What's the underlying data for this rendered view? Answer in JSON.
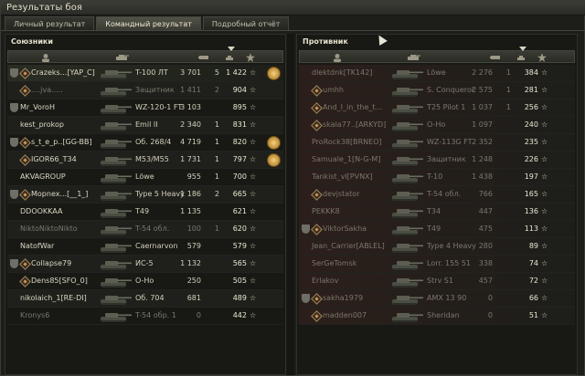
{
  "window": {
    "title": "Результаты боя"
  },
  "tabs": [
    {
      "label": "Личный результат",
      "active": false
    },
    {
      "label": "Командный результат",
      "active": true
    },
    {
      "label": "Подробный отчёт",
      "active": false
    }
  ],
  "allies": {
    "title": "Союзники",
    "rows": [
      {
        "clan_badge": true,
        "platoon": true,
        "name": "Crazeks...[YAP_C]",
        "vehicle": "T-100 ЛТ",
        "damage": "3 701",
        "kills": "5",
        "xp": "1 422",
        "medal": true,
        "dead": false,
        "highlight": true
      },
      {
        "clan_badge": false,
        "platoon": true,
        "name": "....jva.....",
        "vehicle": "Защитник",
        "damage": "1 411",
        "kills": "2",
        "xp": "904",
        "medal": false,
        "dead": true,
        "highlight": false
      },
      {
        "clan_badge": true,
        "platoon": false,
        "name": "Mr_VoroH",
        "vehicle": "WZ-120-1 FT",
        "damage": "3 103",
        "kills": "",
        "xp": "895",
        "medal": false,
        "dead": false,
        "highlight": false
      },
      {
        "clan_badge": false,
        "platoon": false,
        "name": "kest_prokop",
        "vehicle": "Emil II",
        "damage": "2 340",
        "kills": "1",
        "xp": "831",
        "medal": false,
        "dead": false,
        "highlight": false
      },
      {
        "clan_badge": true,
        "platoon": true,
        "name": "s_t_e_p..[GG-BB]",
        "vehicle": "Об. 268/4",
        "damage": "4 719",
        "kills": "1",
        "xp": "820",
        "medal": true,
        "dead": false,
        "highlight": false
      },
      {
        "clan_badge": false,
        "platoon": true,
        "name": "IGOR66_T34",
        "vehicle": "M53/M55",
        "damage": "1 731",
        "kills": "1",
        "xp": "797",
        "medal": true,
        "dead": false,
        "highlight": false
      },
      {
        "clan_badge": false,
        "platoon": false,
        "name": "AKVAGROUP",
        "vehicle": "Löwe",
        "damage": "955",
        "kills": "1",
        "xp": "700",
        "medal": false,
        "dead": false,
        "highlight": false
      },
      {
        "clan_badge": true,
        "platoon": true,
        "name": "Mopnex...[__1_]",
        "vehicle": "Type 5 Heavy",
        "damage": "1 186",
        "kills": "2",
        "xp": "665",
        "medal": false,
        "dead": false,
        "highlight": false
      },
      {
        "clan_badge": false,
        "platoon": false,
        "name": "DDOOKKAA",
        "vehicle": "T49",
        "damage": "1 135",
        "kills": "",
        "xp": "621",
        "medal": false,
        "dead": false,
        "highlight": false
      },
      {
        "clan_badge": false,
        "platoon": false,
        "name": "NiktoNiktoNikto",
        "vehicle": "T-54 обл.",
        "damage": "100",
        "kills": "1",
        "xp": "620",
        "medal": false,
        "dead": true,
        "highlight": false
      },
      {
        "clan_badge": false,
        "platoon": false,
        "name": "NatofWar",
        "vehicle": "Caernarvon",
        "damage": "579",
        "kills": "",
        "xp": "579",
        "medal": false,
        "dead": false,
        "highlight": false
      },
      {
        "clan_badge": true,
        "platoon": true,
        "name": "Collapse79",
        "vehicle": "ИС-5",
        "damage": "1 132",
        "kills": "",
        "xp": "565",
        "medal": false,
        "dead": false,
        "highlight": false
      },
      {
        "clan_badge": false,
        "platoon": true,
        "name": "Dens85[SFO_0]",
        "vehicle": "O-Ho",
        "damage": "250",
        "kills": "",
        "xp": "505",
        "medal": false,
        "dead": false,
        "highlight": false
      },
      {
        "clan_badge": false,
        "platoon": false,
        "name": "nikolaich_1[RE-DI]",
        "vehicle": "Об. 704",
        "damage": "681",
        "kills": "",
        "xp": "489",
        "medal": false,
        "dead": false,
        "highlight": false
      },
      {
        "clan_badge": false,
        "platoon": false,
        "name": "Kronys6",
        "vehicle": "T-54 обр. 1",
        "damage": "0",
        "kills": "",
        "xp": "442",
        "medal": false,
        "dead": true,
        "highlight": false
      }
    ]
  },
  "enemies": {
    "title": "Противник",
    "rows": [
      {
        "clan_badge": false,
        "platoon": false,
        "name": "dlektdnk[TK142]",
        "vehicle": "Löwe",
        "damage": "2 276",
        "kills": "1",
        "xp": "384",
        "dead": true
      },
      {
        "clan_badge": false,
        "platoon": true,
        "name": "umhh",
        "vehicle": "S. Conqueror",
        "damage": "2 575",
        "kills": "1",
        "xp": "281",
        "dead": true
      },
      {
        "clan_badge": false,
        "platoon": true,
        "name": "And_I_in_the_t...",
        "vehicle": "T25 Pilot 1",
        "damage": "1 037",
        "kills": "1",
        "xp": "256",
        "dead": true
      },
      {
        "clan_badge": false,
        "platoon": true,
        "name": "skala77..[ARKYD]",
        "vehicle": "O-Ho",
        "damage": "1 097",
        "kills": "",
        "xp": "240",
        "dead": true
      },
      {
        "clan_badge": false,
        "platoon": false,
        "name": "ProRock38[BRNEO]",
        "vehicle": "WZ-113G FT",
        "damage": "2 352",
        "kills": "",
        "xp": "235",
        "dead": true
      },
      {
        "clan_badge": false,
        "platoon": false,
        "name": "Samuale_1[N-G-M]",
        "vehicle": "Защитник",
        "damage": "1 248",
        "kills": "",
        "xp": "226",
        "dead": true
      },
      {
        "clan_badge": false,
        "platoon": false,
        "name": "Tankist_vl[PVNX]",
        "vehicle": "T-10",
        "damage": "1 438",
        "kills": "",
        "xp": "197",
        "dead": true
      },
      {
        "clan_badge": false,
        "platoon": true,
        "name": "devjstator",
        "vehicle": "T-54 обл.",
        "damage": "766",
        "kills": "",
        "xp": "165",
        "dead": true
      },
      {
        "clan_badge": false,
        "platoon": false,
        "name": "PEKKK8",
        "vehicle": "T34",
        "damage": "447",
        "kills": "",
        "xp": "136",
        "dead": true
      },
      {
        "clan_badge": true,
        "platoon": true,
        "name": "ViktorSakha",
        "vehicle": "T49",
        "damage": "475",
        "kills": "",
        "xp": "113",
        "dead": true
      },
      {
        "clan_badge": false,
        "platoon": false,
        "name": "Jean_Carrier[ABLEL]",
        "vehicle": "Type 4 Heavy",
        "damage": "280",
        "kills": "",
        "xp": "89",
        "dead": true
      },
      {
        "clan_badge": false,
        "platoon": false,
        "name": "SerGeTomsk",
        "vehicle": "Lorr. 155 51",
        "damage": "338",
        "kills": "",
        "xp": "74",
        "dead": true
      },
      {
        "clan_badge": false,
        "platoon": false,
        "name": "Erlakov",
        "vehicle": "Strv S1",
        "damage": "457",
        "kills": "",
        "xp": "72",
        "dead": true
      },
      {
        "clan_badge": true,
        "platoon": true,
        "name": "sakha1979",
        "vehicle": "AMX 13 90",
        "damage": "0",
        "kills": "",
        "xp": "66",
        "dead": true
      },
      {
        "clan_badge": false,
        "platoon": true,
        "name": "madden007",
        "vehicle": "Sheridan",
        "damage": "0",
        "kills": "",
        "xp": "51",
        "dead": true
      }
    ]
  },
  "icons": {
    "xp_star": "☆",
    "sort_arrow": "▾"
  }
}
